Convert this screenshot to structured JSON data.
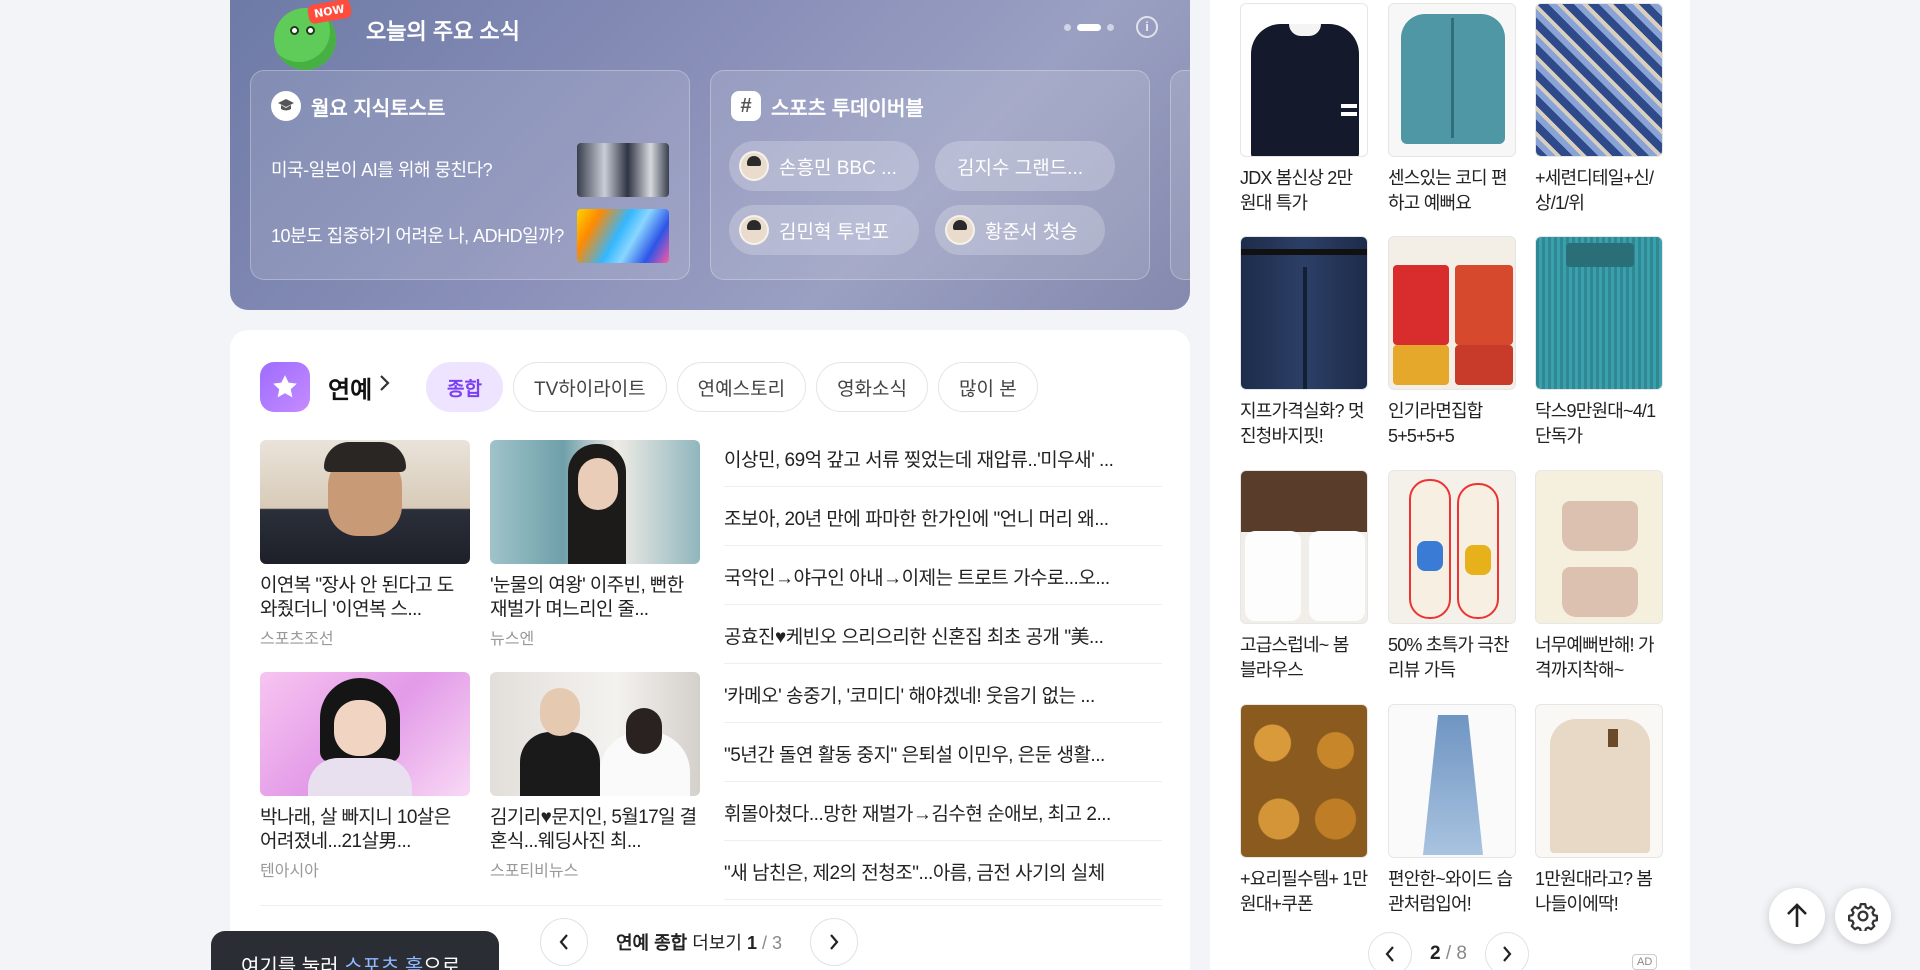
{
  "news": {
    "badge": "NOW",
    "title": "오늘의 주요 소식",
    "info": "i",
    "panels": [
      {
        "title": "월요 지식토스트",
        "items": [
          {
            "text": "미국-일본이 AI를 위해 뭉친다?"
          },
          {
            "text": "10분도 집중하기 어려운 나, ADHD일까?"
          }
        ]
      },
      {
        "title": "스포츠 투데이버블",
        "chips": [
          "손흥민 BBC ...",
          "김지수 그랜드...",
          "김민혁 투런포",
          "황준서 첫승"
        ]
      }
    ]
  },
  "entertainment": {
    "title": "연예",
    "tabs": [
      "종합",
      "TV하이라이트",
      "연예스토리",
      "영화소식",
      "많이 본"
    ],
    "cards": [
      {
        "title": "이연복 \"장사 안 된다고 도와줬더니 '이연복 스...",
        "source": "스포츠조선"
      },
      {
        "title": "'눈물의 여왕' 이주빈, 뻔한 재벌가 며느리인 줄...",
        "source": "뉴스엔"
      },
      {
        "title": "박나래, 살 빠지니 10살은 어려졌네...21살男...",
        "source": "텐아시아"
      },
      {
        "title": "김기리♥문지인, 5월17일 결혼식...웨딩사진 최...",
        "source": "스포티비뉴스"
      }
    ],
    "headlines": [
      "이상민, 69억 갚고 서류 찢었는데 재압류..'미우새' ...",
      "조보아, 20년 만에 파마한 한가인에 \"언니 머리 왜...",
      "국악인→야구인 아내→이제는 트로트 가수로...오...",
      "공효진♥케빈오 으리으리한 신혼집 최초 공개 \"美...",
      "'카메오' 송중기, '코미디' 해야겠네! 웃음기 없는 ...",
      "\"5년간 돌연 활동 중지\" 은퇴설 이민우, 은둔 생활...",
      "휘몰아쳤다...망한 재벌가→김수현 순애보, 최고 2...",
      "\"새 남친은, 제2의 전청조\"...아름, 금전 사기의 실체"
    ],
    "pager": {
      "label": "연예 종합",
      "more": "더보기",
      "current": "1",
      "total": "/ 3"
    }
  },
  "shopping": {
    "products": [
      {
        "title": "JDX 봄신상 2만원대 특가"
      },
      {
        "title": "센스있는 코디 편하고 예뻐요"
      },
      {
        "title": "+세련디테일+신/상/1/위"
      },
      {
        "title": "지프가격실화? 멋진청바지핏!"
      },
      {
        "title": "인기라면집합 5+5+5+5"
      },
      {
        "title": "닥스9만원대~4/1 단독가"
      },
      {
        "title": "고급스럽네~ 봄 블라우스"
      },
      {
        "title": "50% 초특가 극찬리뷰 가득"
      },
      {
        "title": "너무예뻐반해! 가격까지착해~"
      },
      {
        "title": "+요리필수템+ 1만원대+쿠폰"
      },
      {
        "title": "편안한~와이드 습관처럼입어!"
      },
      {
        "title": "1만원대라고? 봄나들이에딱!"
      }
    ],
    "pager": {
      "current": "2",
      "total": "/ 8"
    },
    "ad": "AD"
  },
  "toast": {
    "pre": "여기를 눌러 ",
    "link": "스포츠 홈",
    "post": "으로"
  },
  "colors": {
    "accent": "#7b3ff2",
    "news_bg": "#7d84ae"
  }
}
